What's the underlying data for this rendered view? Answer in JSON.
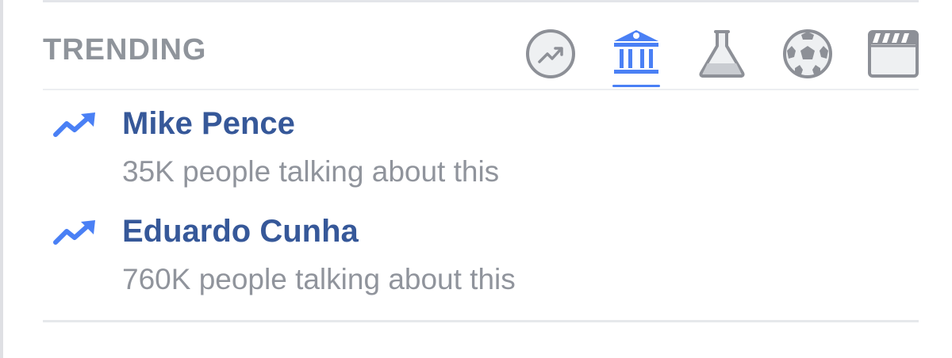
{
  "trending": {
    "title": "TRENDING",
    "tabs": [
      {
        "name": "top-trends",
        "icon": "trending-circle-icon",
        "active": false
      },
      {
        "name": "politics",
        "icon": "government-building-icon",
        "active": true
      },
      {
        "name": "science-technology",
        "icon": "flask-icon",
        "active": false
      },
      {
        "name": "sports",
        "icon": "soccer-ball-icon",
        "active": false
      },
      {
        "name": "entertainment",
        "icon": "clapperboard-icon",
        "active": false
      }
    ],
    "items": [
      {
        "title": "Mike Pence",
        "subtitle": "35K people talking about this",
        "icon": "trending-arrow-icon"
      },
      {
        "title": "Eduardo Cunha",
        "subtitle": "760K people talking about this",
        "icon": "trending-arrow-icon"
      }
    ]
  },
  "colors": {
    "accent": "#4a80f5",
    "link": "#365899",
    "muted": "#90949c",
    "icon_gray": "#8d9097"
  }
}
